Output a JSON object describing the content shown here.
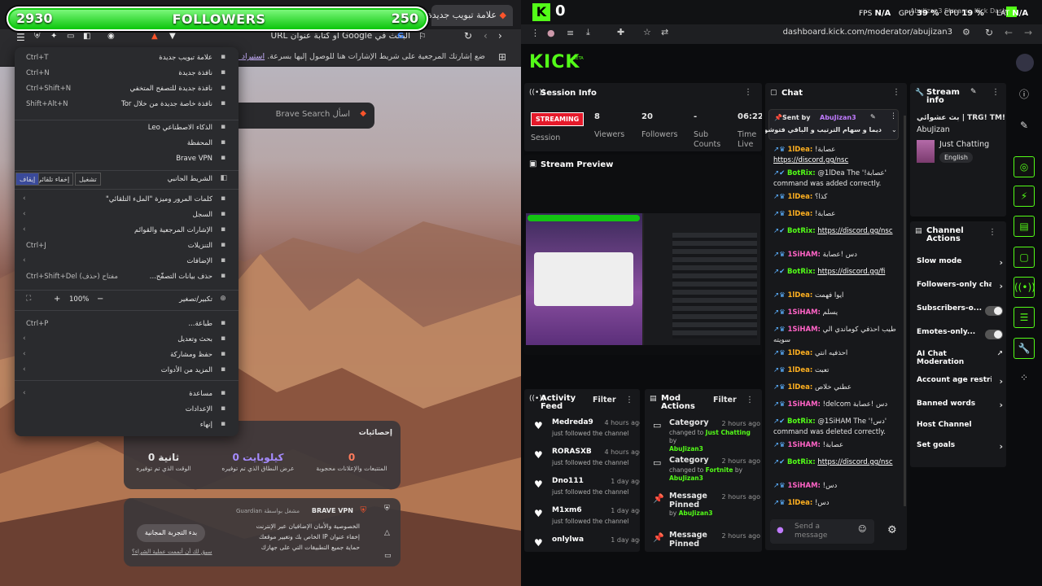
{
  "brave": {
    "tab_title": "علامة تبويب جديدة",
    "url_placeholder": "البحث في Google أو كتابة عنوان URL",
    "bookmarks_notice": "ضع إشارتك المرجعية على شريط الإشارات هنا للوصول إليها بسرعة.",
    "bookmarks_link": "استيراد الإشارات المرجعية...",
    "search_placeholder": "اسأل  Brave Search",
    "menu": [
      {
        "label": "علامة تبويب جديدة",
        "shortcut": "Ctrl+T",
        "icon": "new-tab-icon"
      },
      {
        "label": "نافذة جديدة",
        "shortcut": "Ctrl+N",
        "icon": "new-window-icon"
      },
      {
        "label": "نافذة جديدة للتصفح المتخفي",
        "shortcut": "Ctrl+Shift+N",
        "icon": "private-window-icon"
      },
      {
        "label": "نافذة خاصة جديدة من خلال Tor",
        "shortcut": "Shift+Alt+N",
        "icon": "tor-window-icon"
      },
      {
        "label": "الذكاء الاصطناعي Leo",
        "shortcut": "",
        "icon": "leo-icon"
      },
      {
        "label": "المحفظة",
        "shortcut": "",
        "icon": "wallet-icon"
      },
      {
        "label": "Brave VPN",
        "shortcut": "",
        "icon": "vpn-icon"
      }
    ],
    "sidebar_row": {
      "label": "الشريط الجانبي",
      "b1": "تشغيل",
      "b2": "إخفاء تلقائي",
      "b3": "إيقاف"
    },
    "menu2": [
      {
        "label": "كلمات المرور وميزة \"الملء التلقائي\"",
        "shortcut": "",
        "icon": "key-icon",
        "chev": true
      },
      {
        "label": "السجل",
        "shortcut": "",
        "icon": "history-icon",
        "chev": true
      },
      {
        "label": "الإشارات المرجعية والقوائم",
        "shortcut": "",
        "icon": "bookmark-icon",
        "chev": true
      },
      {
        "label": "التنزيلات",
        "shortcut": "Ctrl+J",
        "icon": "download-icon",
        "chev": false
      },
      {
        "label": "الإضافات",
        "shortcut": "",
        "icon": "extensions-icon",
        "chev": true
      },
      {
        "label": "حذف بيانات التصفّح...",
        "shortcut": "Ctrl+Shift+Del مفتاح (حذف)",
        "icon": "trash-icon",
        "chev": false
      }
    ],
    "zoom": {
      "label": "تكبير/تصغير",
      "value": "100%",
      "plus": "+",
      "minus": "−"
    },
    "menu3": [
      {
        "label": "طباعة...",
        "shortcut": "Ctrl+P",
        "icon": "print-icon",
        "chev": false
      },
      {
        "label": "بحث وتعديل",
        "shortcut": "",
        "icon": "find-icon",
        "chev": true
      },
      {
        "label": "حفظ ومشاركة",
        "shortcut": "",
        "icon": "share-icon",
        "chev": true
      },
      {
        "label": "المزيد من الأدوات",
        "shortcut": "",
        "icon": "tools-icon",
        "chev": true
      }
    ],
    "menu4": [
      {
        "label": "مساعدة",
        "shortcut": "",
        "icon": "help-icon",
        "chev": true
      },
      {
        "label": "الإعدادات",
        "shortcut": "",
        "icon": "settings-icon",
        "chev": false
      },
      {
        "label": "إنهاء",
        "shortcut": "",
        "icon": "close-icon",
        "chev": false
      }
    ],
    "stats": {
      "title": "إحصائيات",
      "blocked_num": "0",
      "blocked_lbl": "المتتبعات والإعلانات محجوبة",
      "bandwidth_num": "0 كيلوبايت",
      "bandwidth_lbl": "عرض النطاق الذي تم توفيره",
      "time_num": "0 ثانية",
      "time_lbl": "الوقت الذي تم توفيره"
    },
    "vpn": {
      "title": "BRAVE VPN",
      "powered": "مشغل بواسطة Guardian",
      "line1": "الخصوصية والأمان الإضافيان عبر الإنترنت",
      "line2": "إخفاء عنوان IP الخاص بك وتغيير موقعك",
      "line3": "حماية جميع التطبيقات التي على جهازك",
      "trial": "بدء التجربة المجانية",
      "already": "سبق لك أن أتممت عملية الشراء؟"
    }
  },
  "followers_overlay": {
    "current": "2930",
    "title": "FOLLOWERS",
    "goal": "250",
    "progress": 1.0
  },
  "kick": {
    "title_bar": "AbuJizan3 Stream - Kick Dashb",
    "stats_overlay": {
      "fps_label": "FPS",
      "fps": "N/A",
      "gpu_label": "GPU",
      "gpu": "39 %",
      "cpu_label": "CPU",
      "cpu": "19 %",
      "lat_label": "LAT",
      "lat": "N/A"
    },
    "logo_counter": "0",
    "url": "dashboard.kick.com/moderator/abujizan3",
    "logo": "KICK",
    "logo_beta": "BETA",
    "session": {
      "title": "Session Info",
      "status": "STREAMING",
      "status_sub": "Session",
      "viewers": "8",
      "viewers_lbl": "Viewers",
      "followers": "20",
      "followers_lbl": "Followers",
      "subs": "-",
      "subs_lbl": "Sub Counts",
      "time": "06:22:",
      "time_lbl": "Time Live"
    },
    "preview_title": "Stream Preview",
    "activity": {
      "title": "Activity Feed",
      "filter": "Filter",
      "items": [
        {
          "name": "Medreda9",
          "time": "4 hours ago",
          "sub": "just followed the channel"
        },
        {
          "name": "RORASXB",
          "time": "4 hours ago",
          "sub": "just followed the channel"
        },
        {
          "name": "Dno111",
          "time": "1 day ago",
          "sub": "just followed the channel"
        },
        {
          "name": "M1xm6",
          "time": "1 day ago",
          "sub": "just followed the channel"
        },
        {
          "name": "onlylwa",
          "time": "1 day ago",
          "sub": ""
        }
      ]
    },
    "mod": {
      "title": "Mod Actions",
      "filter": "Filter",
      "items": [
        {
          "title": "Category",
          "time": "2 hours ago",
          "l1": "changed to ",
          "l1b": "Just Chatting",
          "l2": "by ",
          "l2b": "AbuJizan3"
        },
        {
          "title": "Category",
          "time": "2 hours ago",
          "l1": "changed to ",
          "l1b": "Fortnite",
          "l2": " by ",
          "l2b": "AbuJizan3"
        },
        {
          "title": "Message Pinned",
          "time": "2 hours ago",
          "l1": "by ",
          "l1b": "AbuJizan3",
          "l2": "",
          "l2b": ""
        },
        {
          "title": "Message Pinned",
          "time": "2 hours ago",
          "l1": "",
          "l1b": "",
          "l2": "",
          "l2b": ""
        }
      ]
    },
    "chat": {
      "title": "Chat",
      "pinned_sent_by": "Sent by",
      "pinned_user": "AbuJizan3",
      "pinned_text": "ديما و سهام الترتيب و الباقي فتوشوب",
      "send_placeholder": "Send a message",
      "lines": [
        {
          "user": "1lDea:",
          "cls": "u-idea",
          "text": "!عصابة",
          "link": "https://discord.gg/nsc"
        },
        {
          "user": "BotRix:",
          "cls": "u-bot",
          "text": "@1lDea The '!عصابة' command was added correctly.",
          "link": ""
        },
        {
          "user": "1lDea:",
          "cls": "u-idea",
          "text": "كذا؟",
          "link": ""
        },
        {
          "user": "1lDea:",
          "cls": "u-idea",
          "text": "!عصابة",
          "link": ""
        },
        {
          "user": "BotRix:",
          "cls": "u-bot",
          "text": "",
          "link": "https://discord.gg/nsc"
        },
        {
          "user": "1SiHAM:",
          "cls": "u-sih",
          "text": "دس !عصابة",
          "link": ""
        },
        {
          "user": "BotRix:",
          "cls": "u-bot",
          "text": "",
          "link": "https://discord.gg/fi"
        },
        {
          "user": "1lDea:",
          "cls": "u-idea",
          "text": "ايوا فهمت",
          "link": ""
        },
        {
          "user": "1SiHAM:",
          "cls": "u-sih",
          "text": "يسلم",
          "link": ""
        },
        {
          "user": "1SiHAM:",
          "cls": "u-sih",
          "text": "طيب احذفي كوماندي الي سويته",
          "link": ""
        },
        {
          "user": "1lDea:",
          "cls": "u-idea",
          "text": "احذفيه انتي",
          "link": ""
        },
        {
          "user": "1lDea:",
          "cls": "u-idea",
          "text": "تعبت",
          "link": ""
        },
        {
          "user": "1lDea:",
          "cls": "u-idea",
          "text": "عطني خلاص",
          "link": ""
        },
        {
          "user": "1SiHAM:",
          "cls": "u-sih",
          "text": "!delcom دس !عصابة",
          "link": ""
        },
        {
          "user": "BotRix:",
          "cls": "u-bot",
          "text": "@1SiHAM The '!دس' command was deleted correctly.",
          "link": ""
        },
        {
          "user": "1SiHAM:",
          "cls": "u-sih",
          "text": "!عصابة",
          "link": ""
        },
        {
          "user": "BotRix:",
          "cls": "u-bot",
          "text": "",
          "link": "https://discord.gg/nsc"
        },
        {
          "user": "1SiHAM:",
          "cls": "u-sih",
          "text": "!دس",
          "link": ""
        },
        {
          "user": "1lDea:",
          "cls": "u-idea",
          "text": "!دس",
          "link": ""
        }
      ]
    },
    "stream_info": {
      "title": "Stream info",
      "stream_title": "بث عشوائي | TRG! TM!",
      "streamer": "AbuJizan",
      "category": "Just Chatting",
      "language": "English"
    },
    "channel_actions": {
      "title": "Channel Actions",
      "items": [
        {
          "label": "Slow mode",
          "kind": "chev"
        },
        {
          "label": "Followers-only cha",
          "kind": "chev"
        },
        {
          "label": "Subscribers-o...",
          "kind": "toggle"
        },
        {
          "label": "Emotes-only...",
          "kind": "toggle"
        },
        {
          "label": "AI Chat Moderation",
          "kind": "ext"
        },
        {
          "label": "Account age restric",
          "kind": "chev"
        },
        {
          "label": "Banned words",
          "kind": "chev"
        },
        {
          "label": "Host Channel",
          "kind": "none"
        },
        {
          "label": "Set goals",
          "kind": "chev"
        }
      ]
    }
  }
}
